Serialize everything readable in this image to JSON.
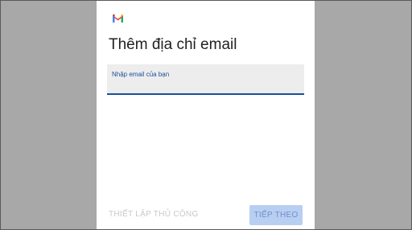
{
  "app": {
    "logo_icon": "gmail-logo-icon"
  },
  "page": {
    "title": "Thêm địa chỉ email"
  },
  "email_field": {
    "label": "Nhập email của bạn",
    "value": ""
  },
  "actions": {
    "manual_setup_label": "THIẾT LẬP THỦ CÔNG",
    "next_label": "TIẾP THEO"
  },
  "colors": {
    "accent": "#1a4f9c",
    "next_button_bg": "#b9cff2",
    "field_bg": "#ededed",
    "side_background": "#a8a8a8"
  }
}
